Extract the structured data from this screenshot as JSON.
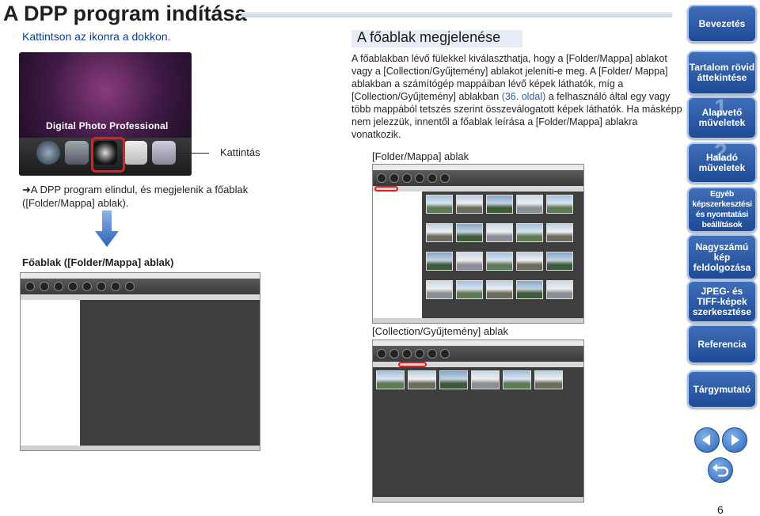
{
  "page": {
    "title": "A DPP program indítása",
    "subtitle": "Kattintson az ikonra a dokkon.",
    "dock_brand": "Digital Photo Professional",
    "click_label": "Kattintás",
    "result_text": "➜A DPP program elindul, és megjelenik a főablak ([Folder/Mappa] ablak).",
    "main_window_caption": "Főablak ([Folder/Mappa] ablak)",
    "page_number": "6"
  },
  "section": {
    "title": "A főablak megjelenése",
    "body_1": "A főablakban lévő fülekkel kiválaszthatja, hogy a [Folder/Mappa] ablakot vagy a [Collection/Gyűjtemény] ablakot jeleníti-e meg. A [Folder/ Mappa] ablakban a számítógép mappáiban lévő képek láthatók, míg a [Collection/Gyűjtemény] ablakban ",
    "link": "(36. oldal)",
    "body_2": " a felhasználó által egy vagy több mappából tetszés szerint összeválogatott képek láthatók. Ha másképp nem jelezzük, innentől a főablak leírása a [Folder/Mappa] ablakra vonatkozik.",
    "folder_caption": "[Folder/Mappa] ablak",
    "collection_caption": "[Collection/Gyűjtemény] ablak"
  },
  "sidebar": {
    "items": [
      {
        "label": "Bevezetés"
      },
      {
        "label": "Tartalom rövid áttekintése"
      },
      {
        "label": "Alapvető műveletek",
        "num": "1"
      },
      {
        "label": "Haladó műveletek",
        "num": "2"
      },
      {
        "label": "Egyéb képszerkesztési és nyomtatási beállítások"
      },
      {
        "label": "Nagyszámú kép feldolgozása"
      },
      {
        "label": "JPEG- és TIFF-képek szerkesztése"
      },
      {
        "label": "Referencia"
      },
      {
        "label": "Tárgymutató"
      }
    ]
  },
  "icons": {
    "prev": "arrow-left-icon",
    "next": "arrow-right-icon",
    "back": "return-icon",
    "down": "arrow-down-icon"
  },
  "colors": {
    "nav_button": "#2c5aa3",
    "highlight_red": "#e02020",
    "link_blue": "#2a5db0",
    "subtitle_blue": "#0b3f8c"
  }
}
